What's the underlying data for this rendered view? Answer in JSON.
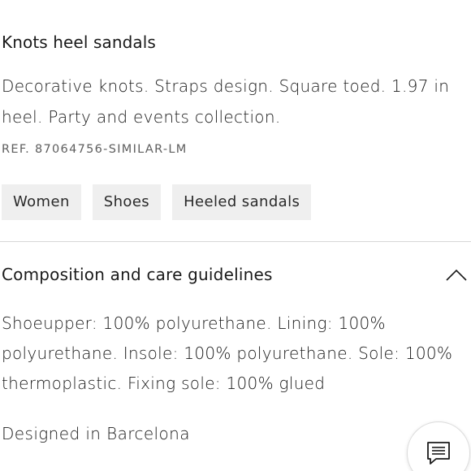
{
  "product": {
    "title": "Knots heel sandals",
    "description": "Decorative knots. Straps design. Square toed. 1.97 in heel. Party and events collection.",
    "reference": "REF. 87064756-SIMILAR-LM",
    "tags": [
      {
        "label": "Women"
      },
      {
        "label": "Shoes"
      },
      {
        "label": "Heeled sandals"
      }
    ]
  },
  "composition": {
    "title": "Composition and care guidelines",
    "expanded": true,
    "toggle_icon": "chevron-up-icon",
    "text": "Shoeupper: 100% polyurethane. Lining: 100% polyurethane. Insole: 100% polyurethane. Sole: 100% thermoplastic. Fixing sole: 100% glued",
    "origin": "Designed in Barcelona"
  },
  "chat": {
    "icon": "chat-icon"
  },
  "colors": {
    "tag_background": "#efefef",
    "divider": "#d8d8d8",
    "text": "#1a1a1a",
    "muted_text": "#5e5e5e"
  }
}
